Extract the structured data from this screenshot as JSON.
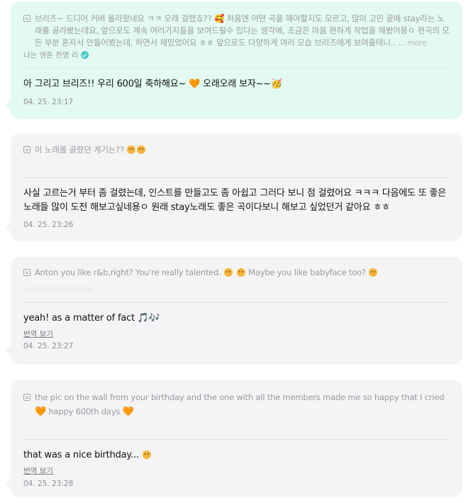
{
  "messages": [
    {
      "quote_text": "브리즈~ 드디어 커버 올라왔네요 ㅋㅋ 오래 걸렸죠?? 🥰 처음엔 어떤 곡을 해야할지도 모르고, 많이 고민 끝에 stay라는 노래를 골라봤는데요, 앞으로도 계속 여러가지들을 보여드릴수 있다는 생각에, 조금은 마음 편하게 작업을 해봤어용ㅇ 편곡의 모든 부분 혼자서 만들어봤는데, 하면서 재밌었어요 ㅎㅎ 앞으로도 다양하게 여러 모습 브리즈에게 보여줄테니.. ...",
      "more_label": "more",
      "author": "나는 앤톤 찬영 리",
      "reply": "아 그리고 브리즈!! 우리 600일 축하해요~",
      "reply_heart": "🧡",
      "reply_tail": "오래오래 보자~~🥳",
      "time": "04. 25. 23:17"
    },
    {
      "quote_text": "이 노래를 골랐던 계기는??",
      "reply": "사실 고르는거 부터 좀 걸렸는데, 인스트를 만들고도 좀 아쉽고 그러다 보니 점 걸렸어요 ㅋㅋㅋ 다음에도 또 좋은 노래들 많이 도전 해보고싶네용ㅇ 원래 stay노래도 좋은 곡이다보니 해보고 싶었던거 같아요 ㅎㅎ",
      "time": "04. 25. 23:26"
    },
    {
      "quote_text": "Anton you like r&b,right? You're really talented.",
      "quote_text_2": "Maybe you like babyface too?",
      "reply": "yeah! as a matter of fact",
      "reply_symbols": "🎵🎶",
      "translate_label": "번역 보기",
      "time": "04. 25. 23:27"
    },
    {
      "quote_text": "the pic on the wall from your birthday and the one with all the members made me so happy that I cried",
      "quote_heart": "🧡",
      "quote_text_2": "happy 600th days",
      "reply": "that was a nice birthday...",
      "translate_label": "번역 보기",
      "time": "04. 25. 23:28"
    }
  ]
}
